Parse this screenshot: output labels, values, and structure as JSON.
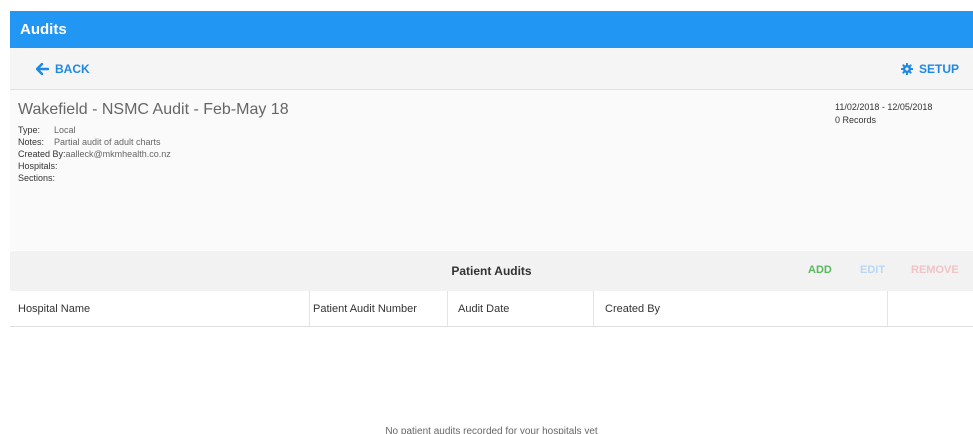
{
  "app": {
    "title": "Audits"
  },
  "toolbar": {
    "back_label": "BACK",
    "setup_label": "SETUP"
  },
  "audit": {
    "title": "Wakefield - NSMC Audit - Feb-May 18",
    "type_label": "Type:",
    "type_value": "Local",
    "notes_label": "Notes:",
    "notes_value": "Partial audit of adult charts",
    "created_by_label": "Created By:",
    "created_by_value": "aalleck@mkmhealth.co.nz",
    "hospitals_label": "Hospitals:",
    "sections_label": "Sections:",
    "date_range": "11/02/2018 - 12/05/2018",
    "records": "0 Records"
  },
  "patient_audits": {
    "title": "Patient Audits",
    "actions": {
      "add": "ADD",
      "edit": "EDIT",
      "remove": "REMOVE"
    },
    "columns": [
      "Hospital Name",
      "Patient Audit Number",
      "Audit Date",
      "Created By"
    ],
    "rows": [],
    "empty_message": "No patient audits recorded for your hospitals yet"
  },
  "colors": {
    "primary": "#2196f3",
    "link": "#1e88e5",
    "add": "#5cb85c",
    "edit_disabled": "#b8d8f3",
    "remove_disabled": "#f0c4c4"
  },
  "icons": {
    "back": "arrow-left-icon",
    "setup": "gear-icon"
  }
}
